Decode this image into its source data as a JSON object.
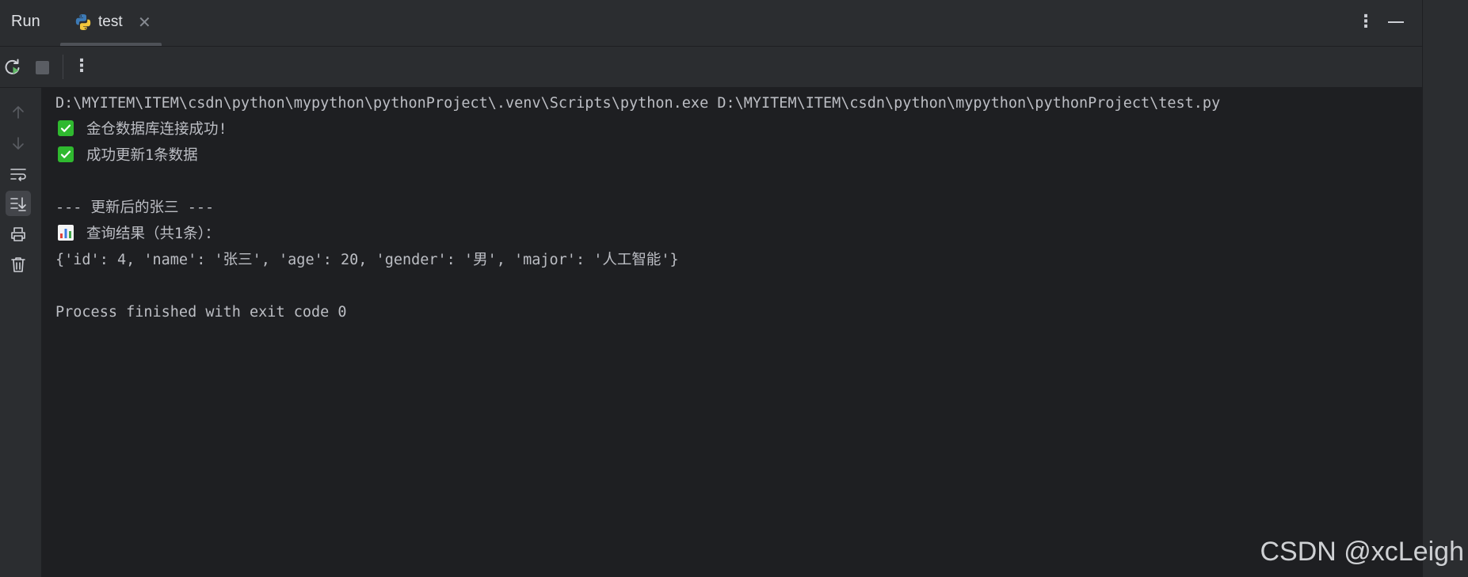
{
  "header": {
    "run_title": "Run",
    "tab": {
      "label": "test",
      "close_glyph": "✕",
      "icon": "python-icon"
    },
    "more_glyph": "⋮",
    "minimize_icon": "minimize-icon"
  },
  "toolbar": {
    "rerun_icon": "rerun-icon",
    "stop_icon": "stop-icon",
    "more_glyph": "⋮"
  },
  "gutter": {
    "items": [
      {
        "icon": "arrow-up-icon"
      },
      {
        "icon": "arrow-down-icon"
      },
      {
        "icon": "soft-wrap-icon"
      },
      {
        "icon": "scroll-to-end-icon",
        "active": true
      },
      {
        "icon": "print-icon"
      },
      {
        "icon": "trash-icon"
      }
    ]
  },
  "console": {
    "lines": [
      {
        "text": "D:\\MYITEM\\ITEM\\csdn\\python\\mypython\\pythonProject\\.venv\\Scripts\\python.exe D:\\MYITEM\\ITEM\\csdn\\python\\mypython\\pythonProject\\test.py"
      },
      {
        "emoji": "check-mark-icon",
        "text": "金仓数据库连接成功!"
      },
      {
        "emoji": "check-mark-icon",
        "text": "成功更新1条数据"
      },
      {
        "text": ""
      },
      {
        "text": "--- 更新后的张三 ---"
      },
      {
        "emoji": "bar-chart-icon",
        "text": "查询结果（共1条）："
      },
      {
        "text": "{'id': 4, 'name': '张三', 'age': 20, 'gender': '男', 'major': '人工智能'}"
      },
      {
        "text": ""
      },
      {
        "text": "Process finished with exit code 0"
      }
    ]
  },
  "watermark": "CSDN @xcLeigh",
  "colors": {
    "background": "#1e1f22",
    "panel": "#2b2d30",
    "text": "#bcbec4",
    "check_green": "#2fb92f"
  }
}
